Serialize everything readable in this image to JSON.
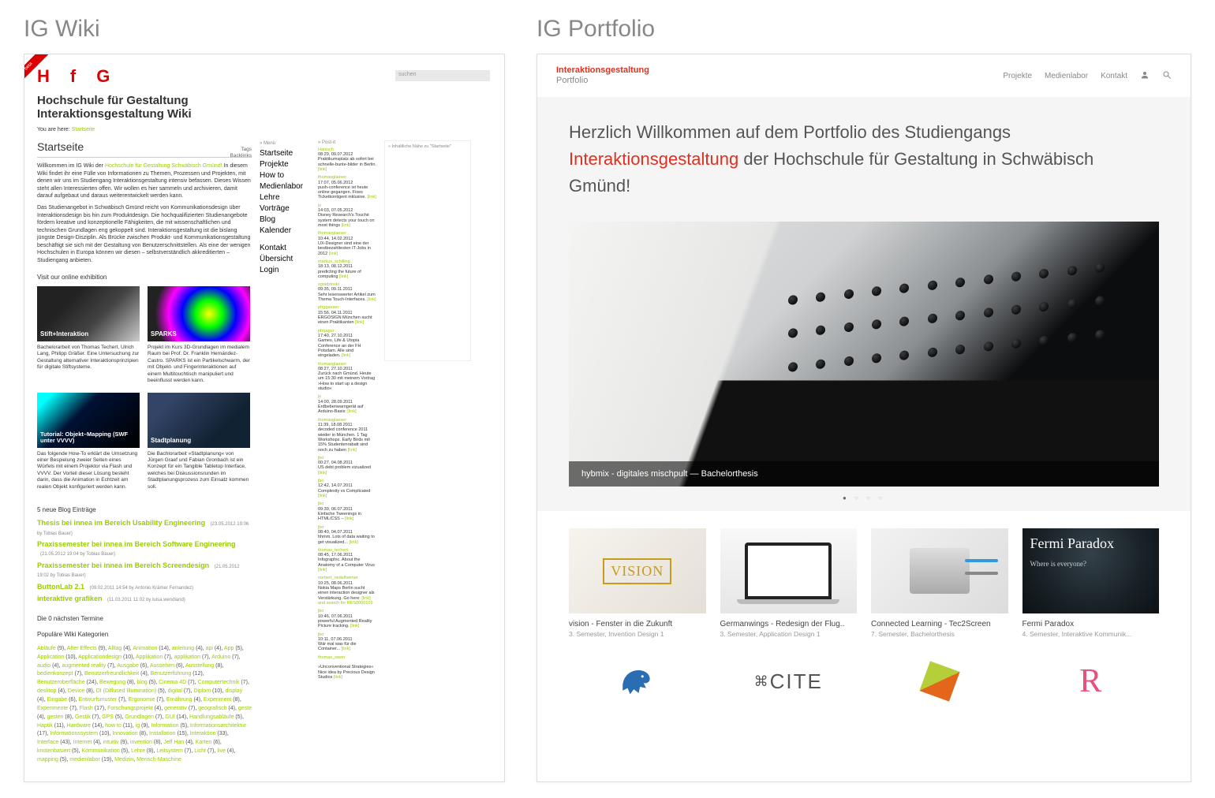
{
  "left_panel_title": "IG Wiki",
  "right_panel_title": "IG Portfolio",
  "wiki": {
    "ribbon": "beta",
    "logo": "HfG",
    "search_placeholder": "suchen",
    "heading_line1": "Hochschule für Gestaltung",
    "heading_line2": "Interaktionsgestaltung Wiki",
    "breadcrumb_label": "You are here:",
    "breadcrumb_link": "Startseite",
    "start_title": "Startseite",
    "tags_label": "Tags",
    "backlinks_label": "Backlinks",
    "intro_p1_a": "Willkommen im IG Wiki der ",
    "intro_p1_link": "Hochschule für Gestaltung Schwäbisch Gmünd!",
    "intro_p1_b": " In diesem Wiki findet ihr eine Fülle von Informationen zu Themen, Prozessen und Projekten, mit denen wir uns im Studiengang Interaktionsgestaltung intensiv befassen. Dieses Wissen steht allen Interessierten offen. Wir wollen es hier sammeln und archivieren, damit darauf aufgebaut und daraus weiterentwickelt werden kann.",
    "intro_p2": "Das Studienangebot in Schwäbisch Gmünd reicht von Kommunikationsdesign über Interaktionsdesign bis hin zum Produktdesign. Die hochqualifizierten Studienangebote fördern kreative und konzeptionelle Fähigkeiten, die mit wissenschaftlichen und technischen Grundlagen eng gekoppelt sind. Interaktionsgestaltung ist die bislang jüngste Design-Disziplin. Als Brücke zwischen Produkt- und Kommunikationsgestaltung beschäftigt sie sich mit der Gestaltung von Benutzerschnittstellen. Als eine der wenigen Hochschulen in Europa können wir diesen – selbstverständlich akkreditierten – Studiengang anbieten.",
    "exhibition_label": "Visit our online exhibition",
    "cards": [
      {
        "title": "Stift+Interaktion",
        "desc": "Bachelorarbeit von Thomas Techert, Ulrich Lang, Philipp Gräßer. Eine Untersuchung zur Gestaltung alternativer Interaktionsprinzipien für digitale Stiftsysteme."
      },
      {
        "title": "SPARKS",
        "desc": "Projekt im Kurs 3D-Grundlagen im medialem Raum bei Prof. Dr. Franklin Hernández-Castro. SPARKS ist ein Partikelschwarm, der mit Objekt- und Fingerinteraktionen auf einem Multitouchtisch manipuliert und beeinflusst werden kann."
      },
      {
        "title": "Tutorial: Objekt–Mapping (SWF unter VVVV)",
        "desc": "Das folgende How-To erklärt die Umsetzung einer Bespielung zweier Seiten eines Würfels mit einem Projektor via Flash und VVVV. Der Vorteil dieser Lösung besteht darin, dass die Animation in Echtzeit am realen Objekt konfiguriert werden kann."
      },
      {
        "title": "Stadtplanung",
        "desc": "Die Bachlorarbeit »Stadtplanung« von Jürgen Graef und Fabian Gronbach ist ein Konzept für ein Tangible Tabletop Interface, welches bei Diskussionsrunden im Stadtplanungsprozess zum Einsatz kommen soll."
      }
    ],
    "blog_heading": "5 neue Blog Einträge",
    "blog": [
      {
        "t": "Thesis bei innea im Bereich Usability Engineering",
        "m": "(23.05.2012 19:06 by Tobias Bauer)"
      },
      {
        "t": "Praxissemester bei innea im Bereich Software Engineering",
        "m": "(21.05.2012 19:04 by Tobias Bauer)"
      },
      {
        "t": "Praxissemester bei innea im Bereich Screendesign",
        "m": "(21.05.2012 19:02 by Tobias Bauer)"
      },
      {
        "t": "ButtonLab 2.1",
        "m": "(09.02.2011 14:54 by Antonio Krämer Fernandez)"
      },
      {
        "t": "interaktive grafiken",
        "m": "(11.03.2011 11:02 by luisa.wendland)"
      }
    ],
    "termine_label": "Die 0 nächsten Termine",
    "popular_label": "Populäre Wiki Kategorien",
    "menu_label": "» Menü",
    "menu": [
      "Startseite",
      "Projekte",
      "How to",
      "Medienlabor",
      "Lehre",
      "Vorträge",
      "Blog",
      "Kalender"
    ],
    "menu2": [
      "Kontakt",
      "Übersicht",
      "Login"
    ],
    "posts_label": "» Post-it",
    "near_label": "» Inhaltliche Nähe zu \"Startseite\"",
    "posts": [
      {
        "u": "Hanisch",
        "d": "08:29, 09.07.2012",
        "t": "Praktikumsplatz ab sofort bei schnelle-bunte-bilder in Berlin.",
        "l": "[link]"
      },
      {
        "u": "thomasglaeser",
        "d": "17:07, 05.06.2012",
        "t": "push-conference ist heute online gegangen. Fixes Ticketkontigent inklusive.",
        "l": "[link]"
      },
      {
        "u": "js",
        "d": "14:03, 07.05.2012",
        "t": "Disney Research's Touché system detects your touch on most things",
        "l": "[link]"
      },
      {
        "u": "thomasglaeser",
        "d": "10:44, 14.02.2012",
        "t": "UX-Designer sind eine der bestbezahltesten IT-Jobs in 2012",
        "l": "[link]"
      },
      {
        "u": "markus_schilling",
        "d": "18:13, 08.12.2011",
        "t": "predicting the future of computing",
        "l": "[link]"
      },
      {
        "u": "sgoidzinski",
        "d": "09:35, 09.11.2011",
        "t": "Sehr lesenswerter Artikel zum Thema Touch-Interfaces.",
        "l": "[link]"
      },
      {
        "u": "pfrggaeser",
        "d": "15:56, 04.11.2011",
        "t": "ERGOSIGN München sucht einen Praktikanten",
        "l": "[link]"
      },
      {
        "u": "pfrqager",
        "d": "17:40, 27.10.2011",
        "t": "Games, Life & Utopia Conference an der FH Potsdam. Alle sind eingeladen.",
        "l": "[link]"
      },
      {
        "u": "thomasglaeser",
        "d": "08:27, 27.10.2011",
        "t": "Zurück nach Gmünd. Heute um 15:30 mit meinem Vortrag »How to start up a design studio«",
        "l": ""
      },
      {
        "u": "js",
        "d": "14:00, 28.09.2011",
        "t": "Erdbebenwarngerät auf Arduino-Basis:",
        "l": "[link]"
      },
      {
        "u": "thomasglaeser",
        "d": "11:39, 18.08.2011",
        "t": "decoded conference 2011 wieder in München. 1 Tag Workshops. Early Birds mit 15% Studentenrabatt sind noch zu haben",
        "l": "[link]"
      },
      {
        "u": "jbo",
        "d": "00:27, 04.08.2011",
        "t": "US debt problem vizualized",
        "l": "[link]"
      },
      {
        "u": "jbo",
        "d": "12:42, 14.07.2011",
        "t": "Complexity vs Complicated",
        "l": "[link]"
      },
      {
        "u": "jbo",
        "d": "09:39, 06.07.2011",
        "t": "Einfache Tweenings in HTML/CSS –",
        "l": "[link]"
      },
      {
        "u": "jbo",
        "d": "08:40, 04.07.2011",
        "t": "hhmm. Lots of data waiting to get visualized...",
        "l": "[link]"
      },
      {
        "u": "thomas_techert",
        "d": "08:45, 17.06.2011",
        "t": "Infographic. About the Anatomy of a Computer Virus",
        "l": "[link]"
      },
      {
        "u": "norbert_riedelheimer",
        "d": "10:25, 08.06.2011",
        "t": "Nokia Maps Berlin sucht einen interaction designer als Verstärkung. Go here:",
        "l": "[link] and search for RES0000109"
      },
      {
        "u": "jbo",
        "d": "10:46, 07.06.2011",
        "t": "powerful Augmented Reality Picture tracking.",
        "l": "[link]"
      },
      {
        "u": "jbo",
        "d": "10:11, 07.06.2011",
        "t": "Wär mal was für die Container...",
        "l": "[link]"
      },
      {
        "u": "thomas_owen",
        "d": "",
        "t": "»Unconventional Strategies« Nice idea by Precious Design Studios",
        "l": "[link]"
      }
    ],
    "tags": [
      [
        "Abläufe",
        "9"
      ],
      [
        "After Effects",
        "9"
      ],
      [
        "Alltag",
        "4"
      ],
      [
        "Animation",
        "14"
      ],
      [
        "anleitung",
        "4"
      ],
      [
        "api",
        "4"
      ],
      [
        "App",
        "5"
      ],
      [
        "Application",
        "10"
      ],
      [
        "Applicationdesign",
        "10"
      ],
      [
        "Applikation",
        "7"
      ],
      [
        "applikation",
        "7"
      ],
      [
        "Arduino",
        "7"
      ],
      [
        "audio",
        "4"
      ],
      [
        "augmented reality",
        "7"
      ],
      [
        "Ausgabe",
        "6"
      ],
      [
        "Aussehen",
        "6"
      ],
      [
        "Ausstellung",
        "8"
      ],
      [
        "bedienkonzept",
        "7"
      ],
      [
        "Benutzerfreundlichkeit",
        "4"
      ],
      [
        "Benutzerführung",
        "12"
      ],
      [
        "Benutzeroberfläche",
        "24"
      ],
      [
        "Bewegung",
        "8"
      ],
      [
        "blog",
        "5"
      ],
      [
        "Cinema 4D",
        "7"
      ],
      [
        "Computertechnik",
        "7"
      ],
      [
        "desktop",
        "4"
      ],
      [
        "Device",
        "8"
      ],
      [
        "DI (Diffused Illumination)",
        "5"
      ],
      [
        "digital",
        "7"
      ],
      [
        "Diplom",
        "10"
      ],
      [
        "display",
        "4"
      ],
      [
        "Eingabe",
        "6"
      ],
      [
        "Entwurfsmuster",
        "7"
      ],
      [
        "Ergonomie",
        "7"
      ],
      [
        "Ernährung",
        "4"
      ],
      [
        "Experiment",
        "8"
      ],
      [
        "Experimente",
        "7"
      ],
      [
        "Flash",
        "17"
      ],
      [
        "Forschungsprojekt",
        "4"
      ],
      [
        "generativ",
        "7"
      ],
      [
        "geografisch",
        "4"
      ],
      [
        "geste",
        "4"
      ],
      [
        "gesten",
        "8"
      ],
      [
        "Gestik",
        "7"
      ],
      [
        "GPS",
        "5"
      ],
      [
        "Grundlagen",
        "7"
      ],
      [
        "GUI",
        "14"
      ],
      [
        "Handlungsabläufe",
        "5"
      ],
      [
        "Haptik",
        "11"
      ],
      [
        "Hardware",
        "14"
      ],
      [
        "how to",
        "11"
      ],
      [
        "ig",
        "9"
      ],
      [
        "Information",
        "5"
      ],
      [
        "Informationsarchitektur",
        "17"
      ],
      [
        "Informationssystem",
        "10"
      ],
      [
        "Innovation",
        "8"
      ],
      [
        "Installation",
        "15"
      ],
      [
        "Interaktion",
        "33"
      ],
      [
        "Interface",
        "43"
      ],
      [
        "Internet",
        "4"
      ],
      [
        "intuitiv",
        "9"
      ],
      [
        "invention",
        "8"
      ],
      [
        "Jeff Han",
        "4"
      ],
      [
        "Karten",
        "6"
      ],
      [
        "knotenbasiert",
        "5"
      ],
      [
        "Kommunikation",
        "5"
      ],
      [
        "Lehre",
        "8"
      ],
      [
        "Leitsystem",
        "7"
      ],
      [
        "Licht",
        "7"
      ],
      [
        "live",
        "4"
      ],
      [
        "mapping",
        "5"
      ],
      [
        "medienlabor",
        "19"
      ],
      [
        "Medizin",
        ""
      ],
      [
        "Mensch-Maschine",
        ""
      ]
    ]
  },
  "portfolio": {
    "logo_top": "Interaktionsgestaltung",
    "logo_sub": "Portfolio",
    "nav": [
      "Projekte",
      "Medienlabor",
      "Kontakt"
    ],
    "welcome_1": "Herzlich Willkommen auf dem ",
    "welcome_2": "Portfolio",
    "welcome_3": " des Studiengangs ",
    "welcome_4": "Interaktionsgestaltung",
    "welcome_5": " der Hochschule für Gestaltung in Schwäbisch Gmünd!",
    "hero_caption": "hybmix - digitales mischpult — Bachelorthesis",
    "cards": [
      {
        "title": "vision - Fenster in die Zukunft",
        "sub": "3. Semester, Invention Design 1"
      },
      {
        "title": "Germanwings - Redesign der Flug..",
        "sub": "3. Semester, Application Design 1"
      },
      {
        "title": "Connected Learning - Tec2Screen",
        "sub": "7. Semester, Bachelorthesis"
      },
      {
        "title": "Fermi Paradox",
        "sub": "4. Semester, Interaktive Kommunik..."
      }
    ],
    "fermi_title": "Fermi Paradox",
    "fermi_sub": "Where is everyone?",
    "vision_text": "VISION",
    "cite_text": "CITE",
    "r_text": "R"
  }
}
